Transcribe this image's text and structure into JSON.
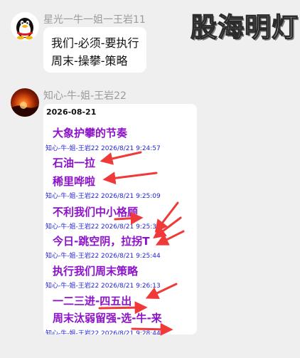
{
  "watermark": {
    "text": "股海明灯"
  },
  "messages": [
    {
      "sender": "星光一牛一姐一王岩11",
      "lines": [
        "我们-必须-要执行",
        "周末-操攀-策略"
      ]
    },
    {
      "sender": "知心-牛-姐-王岩22",
      "card": {
        "date": "2026-08-21",
        "entries": [
          {
            "text": "大象护攀的节奏",
            "meta": "知心-牛-姐-王岩22 2026/8/21 9:24:57"
          },
          {
            "text": "石油一拉",
            "meta": ""
          },
          {
            "text": "稀里哗啦",
            "meta": "知心-牛-姐-王岩22 2026/8/21 9:25:09"
          },
          {
            "text": "不利我们中小格顾",
            "meta": "知心-牛-姐-王岩22 2026/8/21 9:25:34"
          },
          {
            "text": "今日-跳空阴，拉拐T",
            "meta": "知心-牛-姐-王岩22 2026/8/21 9:25:44"
          },
          {
            "text": "执行我们周末策略",
            "meta": "知心-牛-姐-王岩22 2026/8/21 9:26:13"
          },
          {
            "text": "一二三进-四五出",
            "meta": ""
          },
          {
            "text": "周末汰弱留强-选-牛-来",
            "meta": "知心-牛-姐-王岩22 2026/8/21 9:28:44"
          }
        ]
      }
    }
  ],
  "colors": {
    "highlight_text": "#8c12c9",
    "meta_text": "#2424d6",
    "arrow": "#f03a3a"
  },
  "icons": {
    "avatar1": "qq-penguin-icon",
    "avatar2": "sunset-avatar"
  }
}
